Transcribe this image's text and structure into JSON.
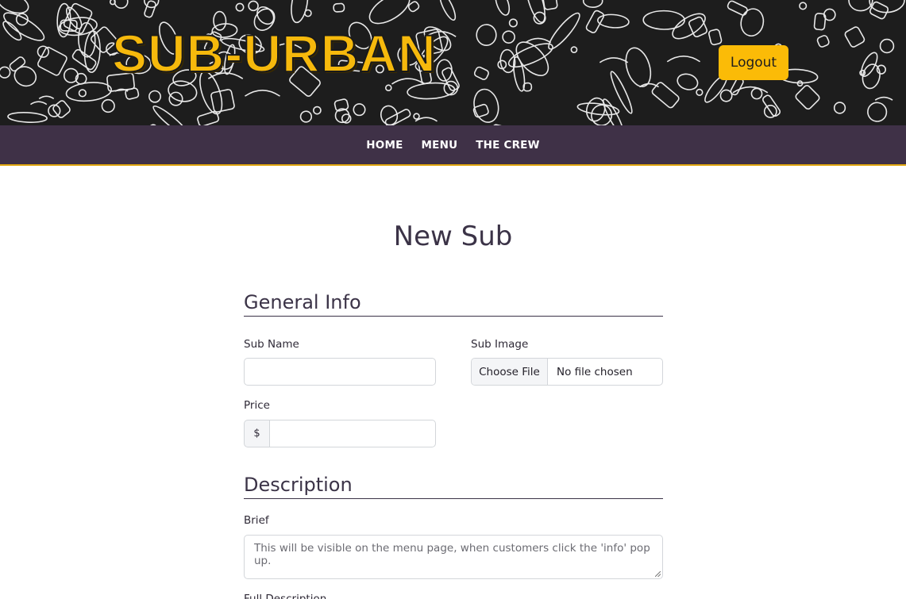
{
  "header": {
    "logo": "SUB-URBAN",
    "logout_label": "Logout",
    "colors": {
      "accent": "#fbbb07",
      "banner_bg": "#1d1d1d",
      "nav_bg": "#3f3147"
    }
  },
  "nav": {
    "items": [
      {
        "label": "HOME"
      },
      {
        "label": "MENU"
      },
      {
        "label": "THE CREW"
      }
    ]
  },
  "page": {
    "title": "New Sub"
  },
  "general_info": {
    "heading": "General Info",
    "sub_name_label": "Sub Name",
    "sub_name_value": "",
    "sub_image_label": "Sub Image",
    "choose_file_label": "Choose File",
    "file_status": "No file chosen",
    "price_label": "Price",
    "price_prefix": "$",
    "price_value": ""
  },
  "description": {
    "heading": "Description",
    "brief_label": "Brief",
    "brief_placeholder": "This will be visible on the menu page, when customers click the 'info' pop up.",
    "full_label": "Full Description"
  }
}
